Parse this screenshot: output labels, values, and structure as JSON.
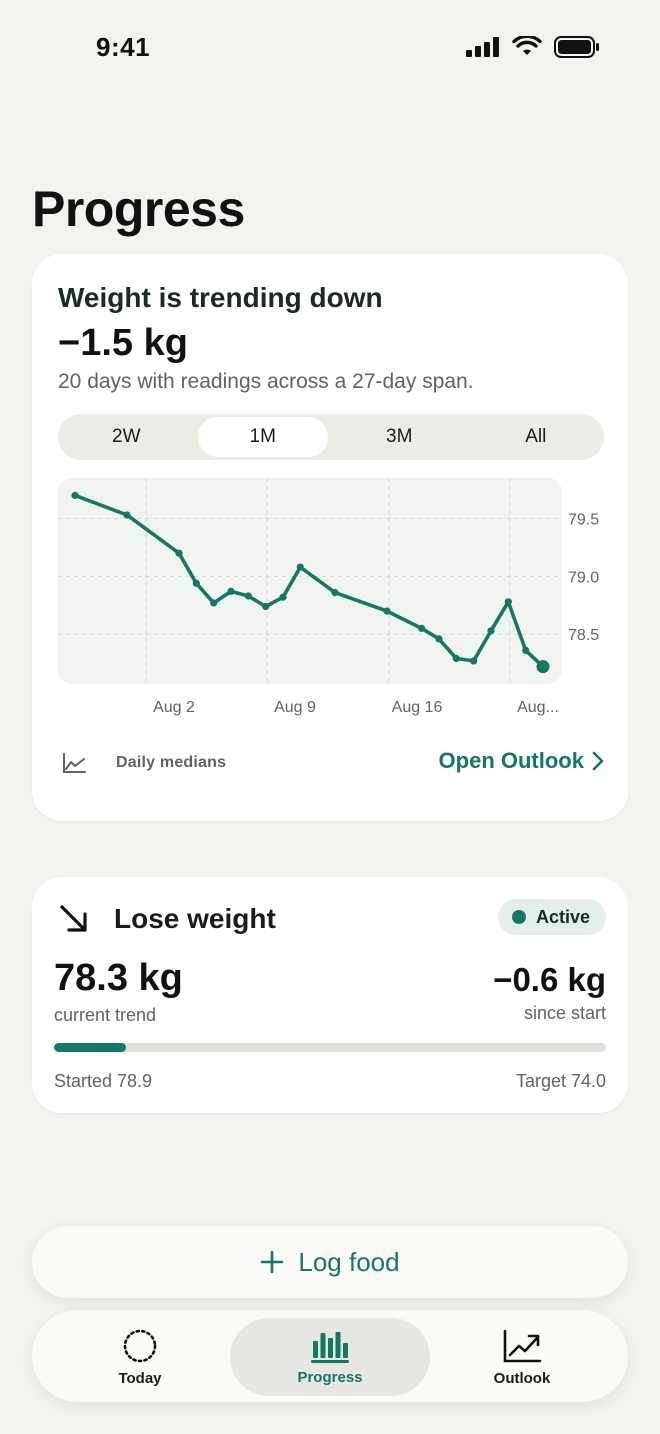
{
  "status_bar": {
    "time": "9:41"
  },
  "page": {
    "title": "Progress"
  },
  "weight_card": {
    "headline": "Weight is trending down",
    "delta": "−1.5 kg",
    "subtitle": "20 days with readings across a 27-day span.",
    "ranges": [
      "2W",
      "1M",
      "3M",
      "All"
    ],
    "selected_range": "1M",
    "legend_label": "Daily medians",
    "open_outlook_label": "Open Outlook"
  },
  "chart_data": {
    "type": "line",
    "x_ticks": [
      "Aug 2",
      "Aug 9",
      "Aug 16",
      "Aug..."
    ],
    "y_ticks": [
      "79.5",
      "79.0",
      "78.5"
    ],
    "ylim": [
      78.07,
      79.85
    ],
    "grid": true,
    "series": [
      {
        "values": [
          79.7,
          79.53,
          79.2,
          78.94,
          78.77,
          78.87,
          78.83,
          78.74,
          78.82,
          79.08,
          78.86,
          78.7,
          78.55,
          78.46,
          78.29,
          78.27,
          78.53,
          78.78,
          78.36,
          78.22
        ]
      }
    ],
    "color": "#137864"
  },
  "goal_card": {
    "title": "Lose weight",
    "status": "Active",
    "current_value": "78.3 kg",
    "current_label": "current trend",
    "change_value": "−0.6 kg",
    "change_label": "since start",
    "progress_fraction": 0.13,
    "started_label": "Started 78.9",
    "target_label": "Target 74.0"
  },
  "actions": {
    "log_food": "Log food"
  },
  "tabs": [
    {
      "label": "Today",
      "icon": "dotted-circle-icon"
    },
    {
      "label": "Progress",
      "icon": "bar-chart-icon"
    },
    {
      "label": "Outlook",
      "icon": "trend-chart-icon"
    }
  ],
  "colors": {
    "accent": "#137864",
    "background": "#f3f2ee"
  }
}
